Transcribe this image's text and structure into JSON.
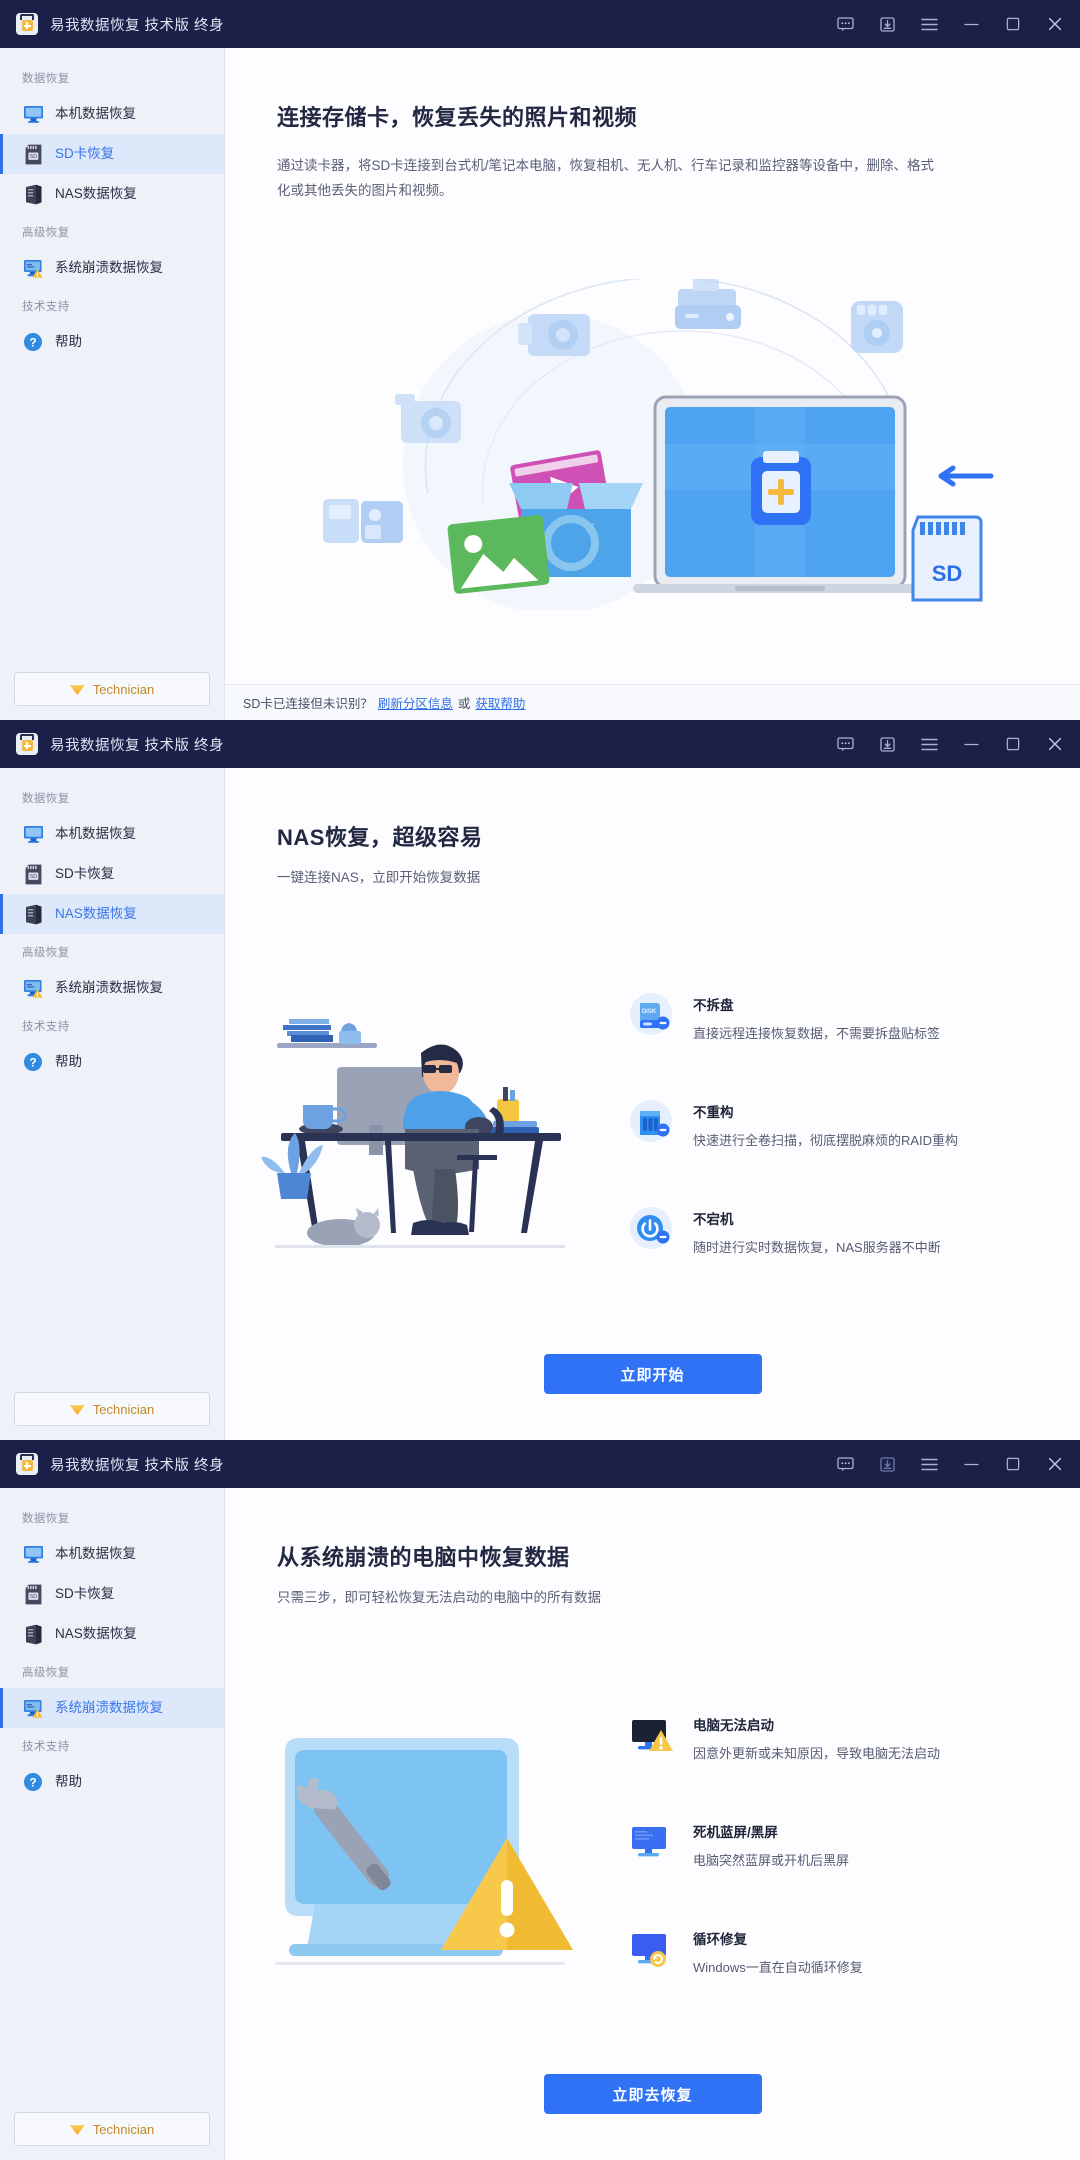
{
  "app": {
    "title": "易我数据恢复 技术版 终身",
    "logo_icon": "toolkit-cross-icon"
  },
  "titlebar_buttons": [
    {
      "name": "feedback-icon",
      "label": "反馈"
    },
    {
      "name": "update-icon",
      "label": "更新"
    },
    {
      "name": "menu-icon",
      "label": "菜单"
    },
    {
      "name": "minimize-icon",
      "label": "最小化"
    },
    {
      "name": "maximize-icon",
      "label": "最大化"
    },
    {
      "name": "close-icon",
      "label": "关闭"
    }
  ],
  "sidebar": {
    "groups": [
      {
        "title": "数据恢复",
        "items": [
          {
            "label": "本机数据恢复",
            "icon": "monitor-icon",
            "key": "local"
          },
          {
            "label": "SD卡恢复",
            "icon": "sdcard-icon",
            "key": "sdcard"
          },
          {
            "label": "NAS数据恢复",
            "icon": "nas-server-icon",
            "key": "nas"
          }
        ]
      },
      {
        "title": "高级恢复",
        "items": [
          {
            "label": "系统崩溃数据恢复",
            "icon": "crash-monitor-icon",
            "key": "crash"
          }
        ]
      },
      {
        "title": "技术支持",
        "items": [
          {
            "label": "帮助",
            "icon": "help-circle-icon",
            "key": "help"
          }
        ]
      }
    ],
    "technician_button": {
      "label": "Technician",
      "icon": "diamond-icon"
    }
  },
  "panels": [
    {
      "active_key": "sdcard",
      "title": "连接存储卡，恢复丢失的照片和视频",
      "subtitle": "通过读卡器，将SD卡连接到台式机/笔记本电脑，恢复相机、无人机、行车记录和监控器等设备中，删除、格式化或其他丢失的图片和视频。",
      "illustration": "sdcard-laptop-media-illustration",
      "statusbar": {
        "text": "SD卡已连接但未识别？",
        "link1": "刷新分区信息",
        "between": "或",
        "link2": "获取帮助"
      }
    },
    {
      "active_key": "nas",
      "title": "NAS恢复，超级容易",
      "subtitle": "一键连接NAS，立即开始恢复数据",
      "illustration": "person-at-desk-illustration",
      "features": [
        {
          "icon": "disk-no-remove-icon",
          "title": "不拆盘",
          "desc": "直接远程连接恢复数据，不需要拆盘贴标签"
        },
        {
          "icon": "raid-bars-icon",
          "title": "不重构",
          "desc": "快速进行全卷扫描，彻底摆脱麻烦的RAID重构"
        },
        {
          "icon": "power-no-shutdown-icon",
          "title": "不宕机",
          "desc": "随时进行实时数据恢复，NAS服务器不中断"
        }
      ],
      "cta": "立即开始"
    },
    {
      "active_key": "crash",
      "title": "从系统崩溃的电脑中恢复数据",
      "subtitle": "只需三步，即可轻松恢复无法启动的电脑中的所有数据",
      "illustration": "broken-monitor-wrench-illustration",
      "features": [
        {
          "icon": "black-screen-warning-icon",
          "title": "电脑无法启动",
          "desc": "因意外更新或未知原因，导致电脑无法启动"
        },
        {
          "icon": "blue-screen-icon",
          "title": "死机蓝屏/黑屏",
          "desc": "电脑突然蓝屏或开机后黑屏"
        },
        {
          "icon": "repair-loop-icon",
          "title": "循环修复",
          "desc": "Windows一直在自动循环修复"
        }
      ],
      "cta": "立即去恢复"
    }
  ],
  "colors": {
    "titlebar_bg": "#1b2049",
    "sidebar_bg": "#eef1f8",
    "accent": "#2f72f5",
    "active_item_bg": "#dde8fb",
    "active_item_text": "#3a76e8",
    "link": "#2f6fe4",
    "technician_gold": "#c08a2a"
  }
}
